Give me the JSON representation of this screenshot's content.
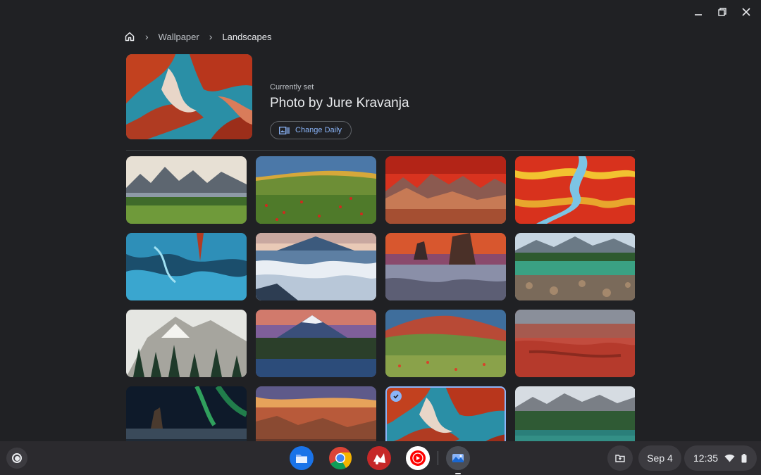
{
  "breadcrumb": {
    "home_icon": "home-icon",
    "items": [
      "Wallpaper",
      "Landscapes"
    ]
  },
  "current": {
    "label": "Currently set",
    "title": "Photo by Jure Kravanja",
    "change_daily_label": "Change Daily"
  },
  "wallpapers": [
    {
      "name": "jagged-mountains-forest",
      "selected": false
    },
    {
      "name": "poppy-field-golden-hills",
      "selected": false
    },
    {
      "name": "red-sky-mountain-range",
      "selected": false
    },
    {
      "name": "red-wetland-river",
      "selected": false
    },
    {
      "name": "blue-ice-cave",
      "selected": false
    },
    {
      "name": "volcano-above-clouds",
      "selected": false
    },
    {
      "name": "sea-stacks-sunset",
      "selected": false
    },
    {
      "name": "alpine-lake-rocks",
      "selected": false
    },
    {
      "name": "snowy-peaks-pines",
      "selected": false
    },
    {
      "name": "snowcapped-volcano-lake",
      "selected": false
    },
    {
      "name": "crater-wildflowers",
      "selected": false
    },
    {
      "name": "red-canyon",
      "selected": false
    },
    {
      "name": "aurora-rock-formations",
      "selected": false
    },
    {
      "name": "grand-canyon-sunset",
      "selected": false
    },
    {
      "name": "antelope-canyon-abstract",
      "selected": true
    },
    {
      "name": "mountain-lake-forest",
      "selected": false
    }
  ],
  "shelf": {
    "apps": [
      "files-icon",
      "chrome-icon",
      "app-icon",
      "youtube-music-icon",
      "wallpaper-app-icon"
    ],
    "date": "Sep 4",
    "time": "12:35"
  },
  "colors": {
    "accent": "#8ab4f8",
    "background": "#202124",
    "shelf": "#2b2a2e"
  }
}
